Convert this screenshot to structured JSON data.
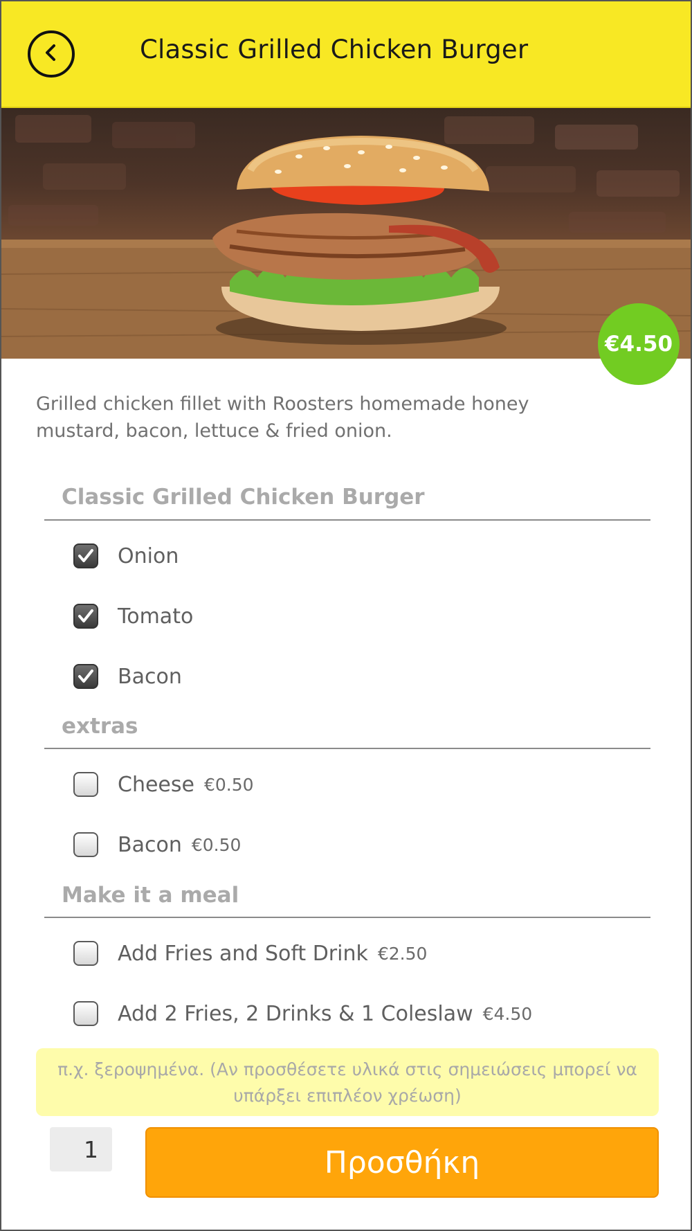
{
  "header": {
    "title": "Classic Grilled Chicken Burger",
    "back_icon": "back-arrow-icon"
  },
  "product": {
    "price": "€4.50",
    "description": "Grilled chicken fillet with Roosters homemade honey mustard, bacon, lettuce & fried onion.",
    "image_icon": "burger-photo"
  },
  "sections": [
    {
      "title": "Classic Grilled Chicken Burger",
      "options": [
        {
          "label": "Onion",
          "price": "",
          "checked": true
        },
        {
          "label": "Tomato",
          "price": "",
          "checked": true
        },
        {
          "label": "Bacon",
          "price": "",
          "checked": true
        }
      ]
    },
    {
      "title": "extras",
      "options": [
        {
          "label": "Cheese",
          "price": "€0.50",
          "checked": false
        },
        {
          "label": "Bacon",
          "price": "€0.50",
          "checked": false
        }
      ]
    },
    {
      "title": "Make it a meal",
      "options": [
        {
          "label": "Add Fries and Soft Drink",
          "price": "€2.50",
          "checked": false
        },
        {
          "label": "Add 2 Fries, 2 Drinks & 1 Coleslaw",
          "price": "€4.50",
          "checked": false
        }
      ]
    }
  ],
  "notes": {
    "placeholder": "π.χ. ξεροψημένα. (Αν προσθέσετε υλικά στις σημειώσεις μπορεί να υπάρξει επιπλέον χρέωση)"
  },
  "quantity": "1",
  "add_button": "Προσθήκη",
  "colors": {
    "header": "#f8e824",
    "price_badge": "#72cc22",
    "add_button": "#ffa50a",
    "notes_bg": "#fefcab"
  }
}
